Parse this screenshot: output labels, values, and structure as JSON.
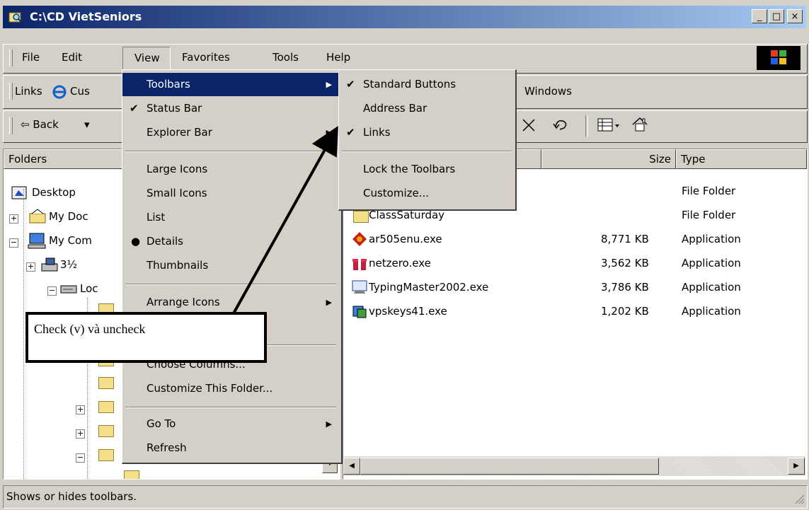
{
  "window": {
    "title": "C:\\CD VietSeniors",
    "min": "_",
    "max": "□",
    "close": "×"
  },
  "menubar": [
    "File",
    "Edit",
    "View",
    "Favorites",
    "Tools",
    "Help"
  ],
  "links_bar": {
    "label": "Links",
    "item1": "Cus",
    "item2": "Windows"
  },
  "nav": {
    "back": "⇦ Back",
    "dropdown": "▾"
  },
  "folders": {
    "header": "Folders",
    "items": [
      "Desktop",
      "My Doc",
      "My Com",
      "3½",
      "Loc"
    ]
  },
  "columns": {
    "size": "Size",
    "type": "Type"
  },
  "files": [
    {
      "name": "",
      "size": "",
      "type": "File Folder"
    },
    {
      "name": "ClassSaturday",
      "size": "",
      "type": "File Folder"
    },
    {
      "name": "ar505enu.exe",
      "size": "8,771 KB",
      "type": "Application"
    },
    {
      "name": "netzero.exe",
      "size": "3,562 KB",
      "type": "Application"
    },
    {
      "name": "TypingMaster2002.exe",
      "size": "3,786 KB",
      "type": "Application"
    },
    {
      "name": "vpskeys41.exe",
      "size": "1,202 KB",
      "type": "Application"
    }
  ],
  "view_menu": [
    "Toolbars",
    "Status Bar",
    "Explorer Bar",
    "Large Icons",
    "Small Icons",
    "List",
    "Details",
    "Thumbnails",
    "Arrange Icons",
    "Choose Columns...",
    "Customize This Folder...",
    "Go To",
    "Refresh"
  ],
  "toolbars_submenu": [
    "Standard Buttons",
    "Address Bar",
    "Links",
    "Lock the Toolbars",
    "Customize..."
  ],
  "status_text": "Shows or hides toolbars.",
  "callout_text": "Check (v) và uncheck",
  "colors": {
    "highlight": "#0a246a",
    "face": "#d4d0c8",
    "title_end": "#a6caf0"
  }
}
